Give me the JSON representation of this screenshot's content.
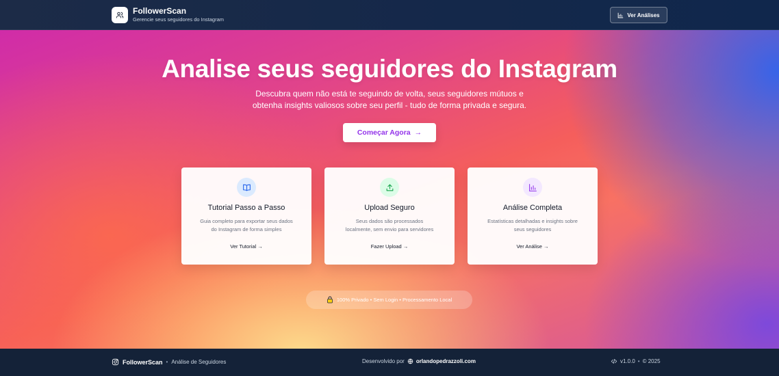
{
  "header": {
    "title": "FollowerScan",
    "subtitle": "Gerencie seus seguidores do Instagram",
    "button_label": "Ver Análises",
    "logo_icon": "users-icon"
  },
  "hero": {
    "title": "Analise seus seguidores do Instagram",
    "description_line1": "Descubra quem não está te seguindo de volta, seus seguidores mútuos e",
    "description_line2": "obtenha insights valiosos sobre seu perfil - tudo de forma privada e segura.",
    "cta_label": "Começar Agora",
    "cta_arrow": "→"
  },
  "cards": [
    {
      "title": "Tutorial Passo a Passo",
      "desc_line1": "Guia completo para exportar seus dados",
      "desc_line2": "do Instagram de forma simples",
      "link": "Ver Tutorial →",
      "icon": "book-icon",
      "icon_color": "#2563eb",
      "icon_bg": "#dbeafe"
    },
    {
      "title": "Upload Seguro",
      "desc_line1": "Seus dados são processados",
      "desc_line2": "localmente, sem envio para servidores",
      "link": "Fazer Upload →",
      "icon": "upload-icon",
      "icon_color": "#16a34a",
      "icon_bg": "#dcfce7"
    },
    {
      "title": "Análise Completa",
      "desc_line1": "Estatísticas detalhadas e insights sobre",
      "desc_line2": "seus seguidores",
      "link": "Ver Análise →",
      "icon": "bar-chart-icon",
      "icon_color": "#9333ea",
      "icon_bg": "#f3e8ff"
    }
  ],
  "privacy": {
    "text": "100% Privado • Sem Login • Processamento Local",
    "icon": "lock-icon"
  },
  "footer": {
    "brand": "FollowerScan",
    "separator": "•",
    "tagline": "Análise de Seguidores",
    "dev_prefix": "Desenvolvido por",
    "site": "orlandopedrazzoli.com",
    "version": "v1.0.0",
    "year": "© 2025"
  },
  "colors": {
    "accent_purple": "#9333ea",
    "header_bg": "#1c2b47",
    "footer_bg": "#142238"
  }
}
